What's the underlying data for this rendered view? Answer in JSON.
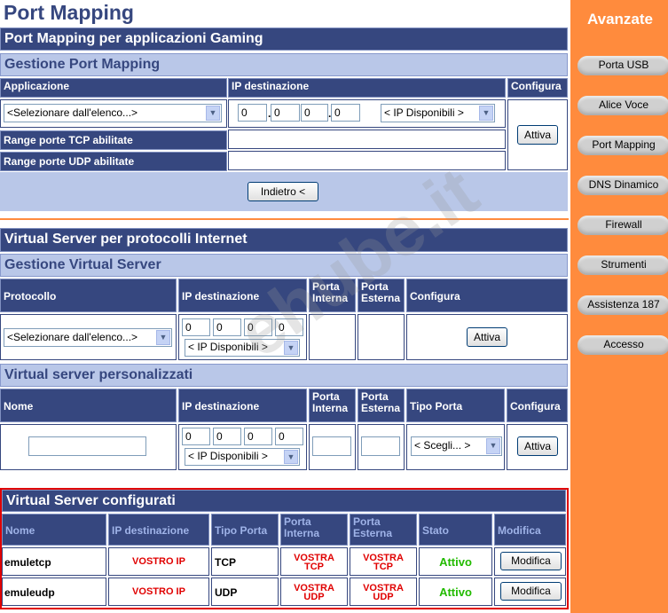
{
  "page_title": "Port Mapping",
  "watermark": "ehube.it",
  "gaming": {
    "title": "Port Mapping per applicazioni Gaming",
    "sub": "Gestione Port Mapping",
    "col_app": "Applicazione",
    "col_ip": "IP destinazione",
    "col_conf": "Configura",
    "app_select": "<Selezionare dall'elenco...>",
    "ip": [
      "0",
      "0",
      "0",
      "0"
    ],
    "ip_select": "< IP Disponibili >",
    "tcp_label": "Range porte TCP abilitate",
    "udp_label": "Range porte UDP abilitate",
    "attiva": "Attiva",
    "indietro": "Indietro <"
  },
  "vs": {
    "title": "Virtual Server per protocolli Internet",
    "sub": "Gestione Virtual Server",
    "col_proto": "Protocollo",
    "col_ip": "IP destinazione",
    "col_pi": "Porta Interna",
    "col_pe": "Porta Esterna",
    "col_conf": "Configura",
    "proto_select": "<Selezionare dall'elenco...>",
    "ip": [
      "0",
      "0",
      "0",
      "0"
    ],
    "ip_select": "< IP Disponibili >",
    "attiva": "Attiva"
  },
  "custom": {
    "title": "Virtual server personalizzati",
    "col_nome": "Nome",
    "col_ip": "IP destinazione",
    "col_pi": "Porta Interna",
    "col_pe": "Porta Esterna",
    "col_tipo": "Tipo Porta",
    "col_conf": "Configura",
    "ip": [
      "0",
      "0",
      "0",
      "0"
    ],
    "ip_select": "< IP Disponibili >",
    "tipo_select": "< Scegli... >",
    "attiva": "Attiva"
  },
  "configured": {
    "title": "Virtual Server configurati",
    "headers": [
      "Nome",
      "IP destinazione",
      "Tipo Porta",
      "Porta Interna",
      "Porta Esterna",
      "Stato",
      "Modifica"
    ],
    "rows": [
      {
        "nome": "emuletcp",
        "ip": "VOSTRO IP",
        "tipo": "TCP",
        "pi": "VOSTRA TCP",
        "pe": "VOSTRA TCP",
        "stato": "Attivo",
        "modifica": "Modifica"
      },
      {
        "nome": "emuleudp",
        "ip": "VOSTRO IP",
        "tipo": "UDP",
        "pi": "VOSTRA UDP",
        "pe": "VOSTRA UDP",
        "stato": "Attivo",
        "modifica": "Modifica"
      }
    ]
  },
  "sidebar": {
    "title": "Avanzate",
    "items": [
      "Porta USB",
      "Alice Voce",
      "Port Mapping",
      "DNS Dinamico",
      "Firewall",
      "Strumenti",
      "Assistenza 187",
      "Accesso"
    ]
  }
}
